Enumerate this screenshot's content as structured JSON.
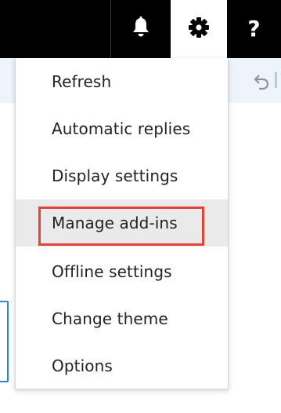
{
  "header": {
    "icons": [
      "bell-icon",
      "gear-icon",
      "help-icon"
    ],
    "help_glyph": "?",
    "bar_color": "#000000"
  },
  "toolbar": {
    "icons": [
      "undo-icon"
    ]
  },
  "settings_menu": {
    "items": [
      {
        "label": "Refresh"
      },
      {
        "label": "Automatic replies"
      },
      {
        "label": "Display settings"
      },
      {
        "label": "Manage add-ins",
        "highlighted": true
      },
      {
        "label": "Offline settings"
      },
      {
        "label": "Change theme"
      },
      {
        "label": "Options"
      }
    ],
    "highlight_color": "#e0443b"
  }
}
